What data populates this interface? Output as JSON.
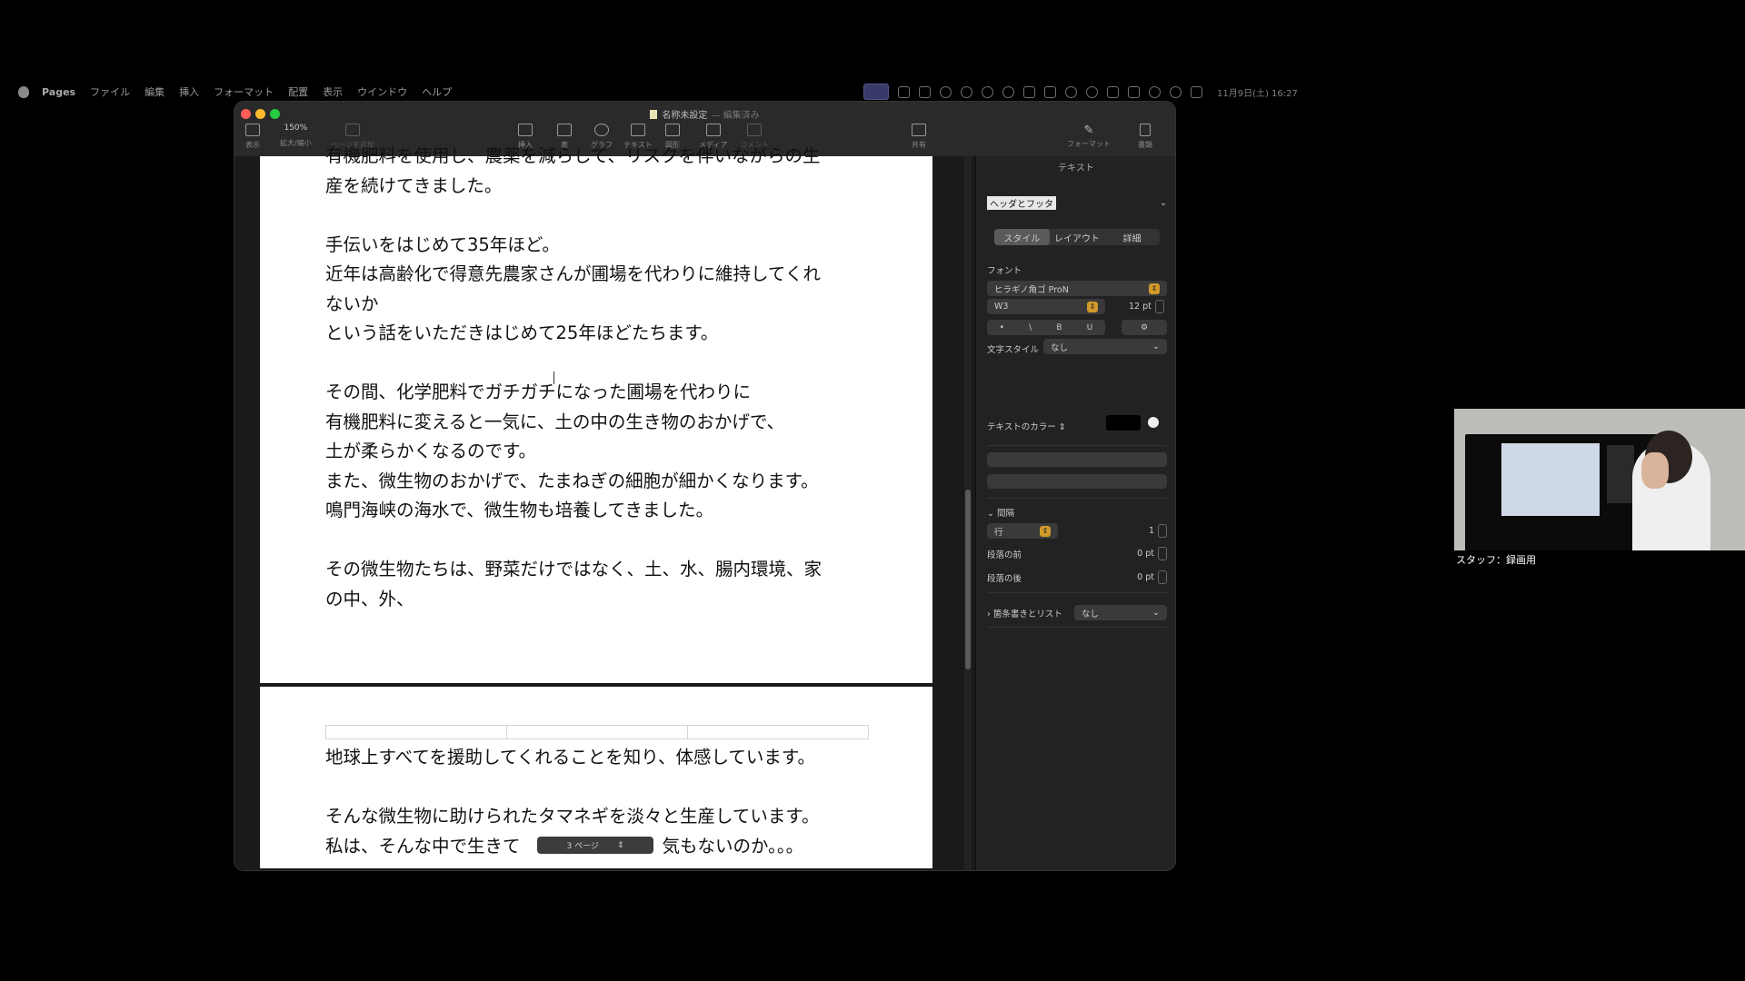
{
  "menubar": {
    "app": "Pages",
    "items": [
      "ファイル",
      "編集",
      "挿入",
      "フォーマット",
      "配置",
      "表示",
      "ウインドウ",
      "ヘルプ"
    ],
    "datetime": "11月9日(土) 16:27"
  },
  "window": {
    "title": "名称未設定",
    "state": "— 編集済み",
    "toolbar": {
      "view": "表示",
      "zoom_value": "150%",
      "zoom": "拡大/縮小",
      "add_page": "ページを追加",
      "insert": "挿入",
      "table": "表",
      "chart": "グラフ",
      "text": "テキスト",
      "shape": "図形",
      "media": "メディア",
      "comment": "コメント",
      "share": "共有",
      "format": "フォーマット",
      "document": "書類"
    }
  },
  "document": {
    "page1_lines": [
      "有機肥料を使用し、農薬を減らして、リスクを伴いながらの生",
      "産を続けてきました。",
      "",
      "手伝いをはじめて35年ほど。",
      "近年は高齢化で得意先農家さんが圃場を代わりに維持してくれ",
      "ないか",
      "という話をいただきはじめて25年ほどたちます。",
      "",
      "その間、化学肥料でガチガチになった圃場を代わりに",
      "有機肥料に変えると一気に、土の中の生き物のおかげで、",
      "土が柔らかくなるのです。",
      "また、微生物のおかげで、たまねぎの細胞が細かくなります。",
      "鳴門海峡の海水で、微生物も培養してきました。",
      "",
      "その微生物たちは、野菜だけではなく、土、水、腸内環境、家",
      "の中、外、"
    ],
    "page2_lines": [
      "地球上すべてを援助してくれることを知り、体感しています。",
      "",
      "そんな微生物に助けられたタマネギを淡々と生産しています。",
      "私は、そんな中で生きて　　　　　　　　気もないのか。。。"
    ],
    "page_indicator": "3 ページ"
  },
  "inspector": {
    "title": "テキスト",
    "paragraph_style": "ヘッダとフッタ",
    "tabs": [
      "スタイル",
      "レイアウト",
      "詳細"
    ],
    "active_tab": "スタイル",
    "font_label": "フォント",
    "font_family": "ヒラギノ角ゴ ProN",
    "font_weight": "W3",
    "font_size": "12 pt",
    "char_style_label": "文字スタイル",
    "char_style_value": "なし",
    "text_color_label": "テキストのカラー",
    "spacing_label": "間隔",
    "line_mode": "行",
    "line_value": "1",
    "before_label": "段落の前",
    "before_value": "0 pt",
    "after_label": "段落の後",
    "after_value": "0 pt",
    "bullets_label": "箇条書きとリスト",
    "bullets_value": "なし"
  },
  "camera": {
    "caption": "スタッフ：録画用"
  }
}
